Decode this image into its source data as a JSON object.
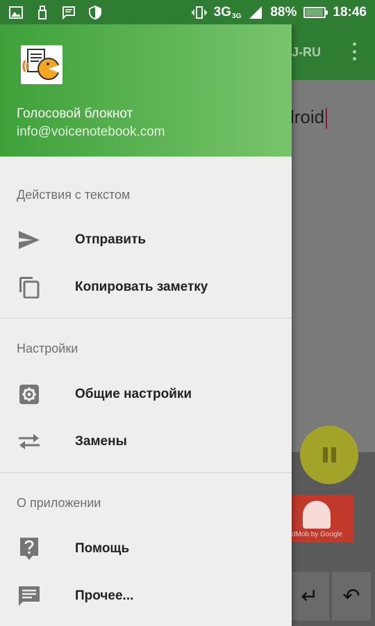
{
  "status_bar": {
    "network": "3G",
    "network_sup": "3G",
    "battery": "88%",
    "battery_level": 0.88,
    "time": "18:46"
  },
  "background_app": {
    "toolbar_lang": "J-RU",
    "editor_text": "lroid",
    "ad_label": "dMob by Google",
    "undo_symbol": "↶",
    "newline_symbol": "↵"
  },
  "drawer": {
    "header": {
      "app_name": "Голосовой блокнот",
      "email": "info@voicenotebook.com"
    },
    "sections": [
      {
        "title": "Действия с текстом",
        "items": [
          {
            "label": "Отправить",
            "icon": "send-icon"
          },
          {
            "label": "Копировать заметку",
            "icon": "copy-icon"
          }
        ]
      },
      {
        "title": "Настройки",
        "items": [
          {
            "label": "Общие настройки",
            "icon": "gear-icon"
          },
          {
            "label": "Замены",
            "icon": "swap-arrows-icon"
          }
        ]
      },
      {
        "title": "О приложении",
        "items": [
          {
            "label": "Помощь",
            "icon": "help-icon"
          },
          {
            "label": "Прочее...",
            "icon": "message-icon"
          }
        ]
      }
    ]
  },
  "colors": {
    "status_bar": "#2e7d32",
    "header_start": "#3ea13a",
    "header_end": "#78c46b",
    "drawer_bg": "#eeeeee",
    "icon": "#757575"
  }
}
